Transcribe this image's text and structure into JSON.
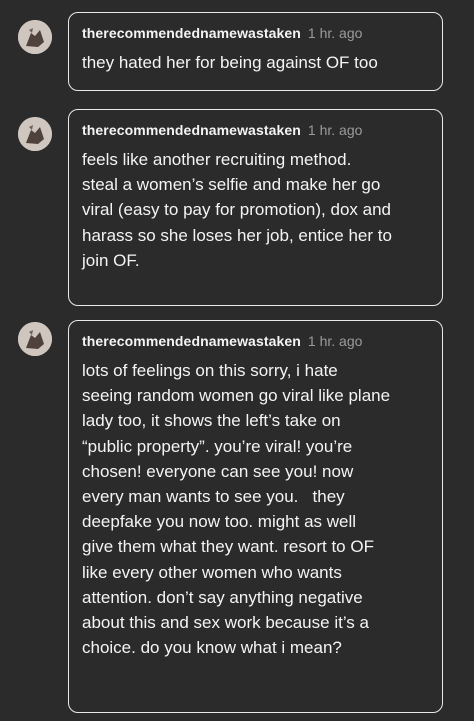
{
  "comments": [
    {
      "username": "therecommendednamewastaken",
      "time": "1 hr. ago",
      "text": "they hated her for being against OF too"
    },
    {
      "username": "therecommendednamewastaken",
      "time": "1 hr. ago",
      "text": "feels like another recruiting method.\nsteal a women’s selfie and make her go\nviral (easy to pay for promotion), dox and\nharass so she loses her job, entice her to\njoin OF."
    },
    {
      "username": "therecommendednamewastaken",
      "time": "1 hr. ago",
      "text": "lots of feelings on this sorry, i hate\nseeing random women go viral like plane\nlady too, it shows the left’s take on\n“public property”. you’re viral! you’re\nchosen! everyone can see you! now\nevery man wants to see you.   they\ndeepfake you now too. might as well\ngive them what they want. resort to OF\nlike every other women who wants\nattention. don’t say anything negative\nabout this and sex work because it’s a\nchoice. do you know what i mean?"
    }
  ]
}
